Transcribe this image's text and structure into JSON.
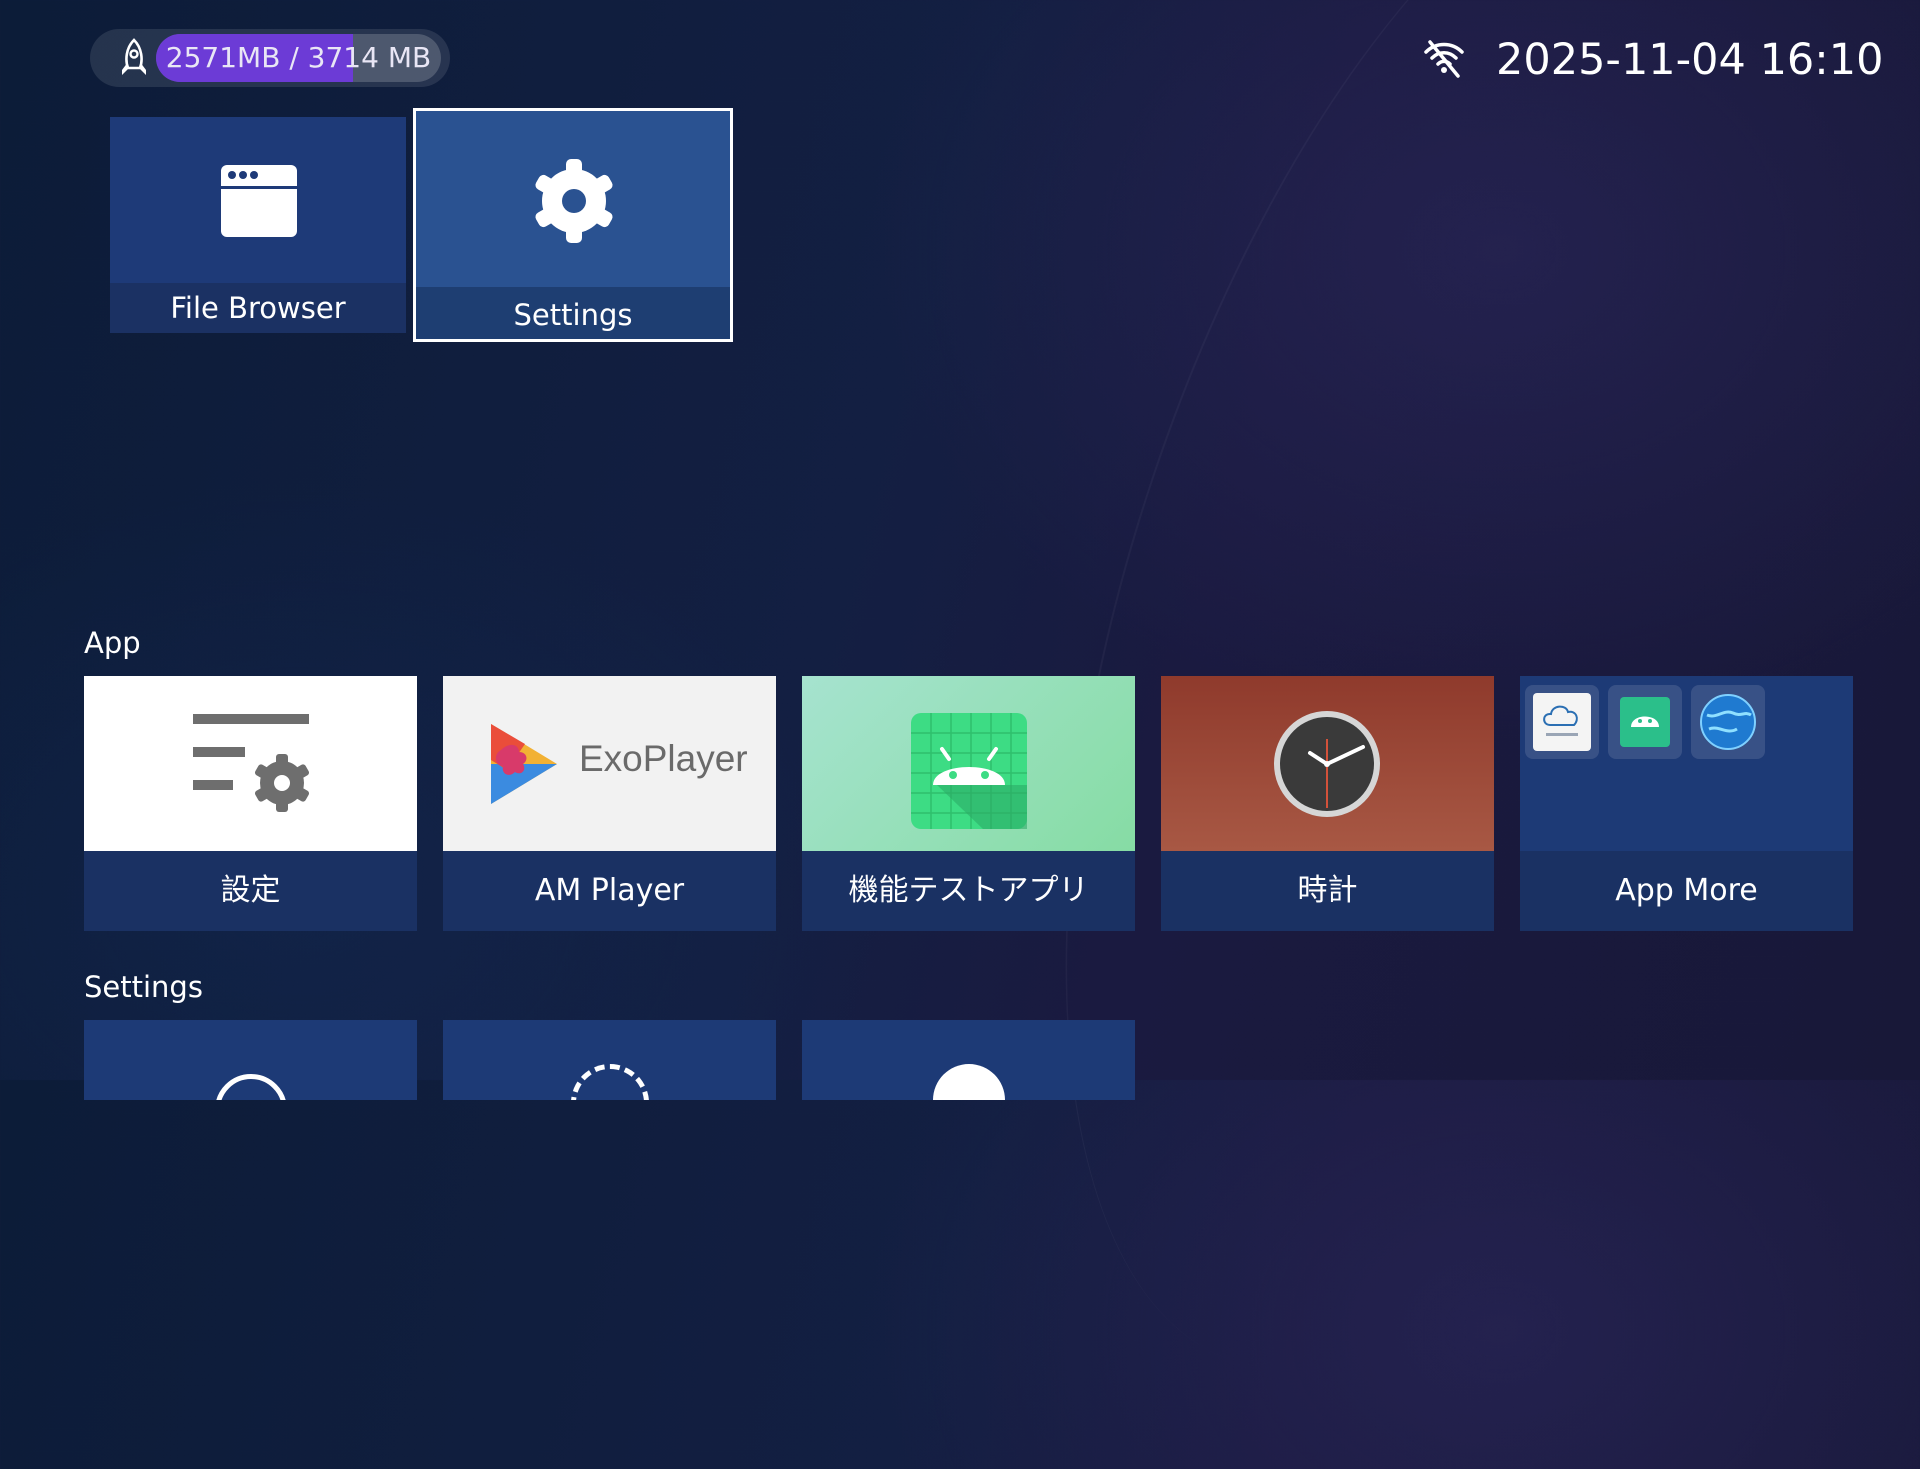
{
  "status_bar": {
    "memory": {
      "text": "2571MB / 3714 MB",
      "used_fraction": 0.692
    },
    "datetime": "2025-11-04 16:10"
  },
  "top_tiles": [
    {
      "label": "File Browser",
      "icon": "browser-window-icon",
      "focused": false
    },
    {
      "label": "Settings",
      "icon": "gear-icon",
      "focused": true
    }
  ],
  "sections": {
    "app": {
      "title": "App",
      "tiles": [
        {
          "label": "設定",
          "icon": "settings-list-icon"
        },
        {
          "label": "AM Player",
          "icon": "exoplayer-logo",
          "logo_text": "ExoPlayer"
        },
        {
          "label": "機能テストアプリ",
          "icon": "android-icon"
        },
        {
          "label": "時計",
          "icon": "clock-icon"
        },
        {
          "label": "App More",
          "icon": "app-more-icon",
          "mini_icons": [
            "iodata-cloud-icon",
            "android-mini-icon",
            "globe-icon"
          ]
        }
      ]
    },
    "settings": {
      "title": "Settings",
      "tile_count": 3
    }
  },
  "colors": {
    "memory_fill": "#6c3bd6",
    "tile_bg": "#1a3163",
    "focus_border": "#ffffff",
    "android_green": "#3ddc84",
    "clock_bg": "#a0503c"
  }
}
